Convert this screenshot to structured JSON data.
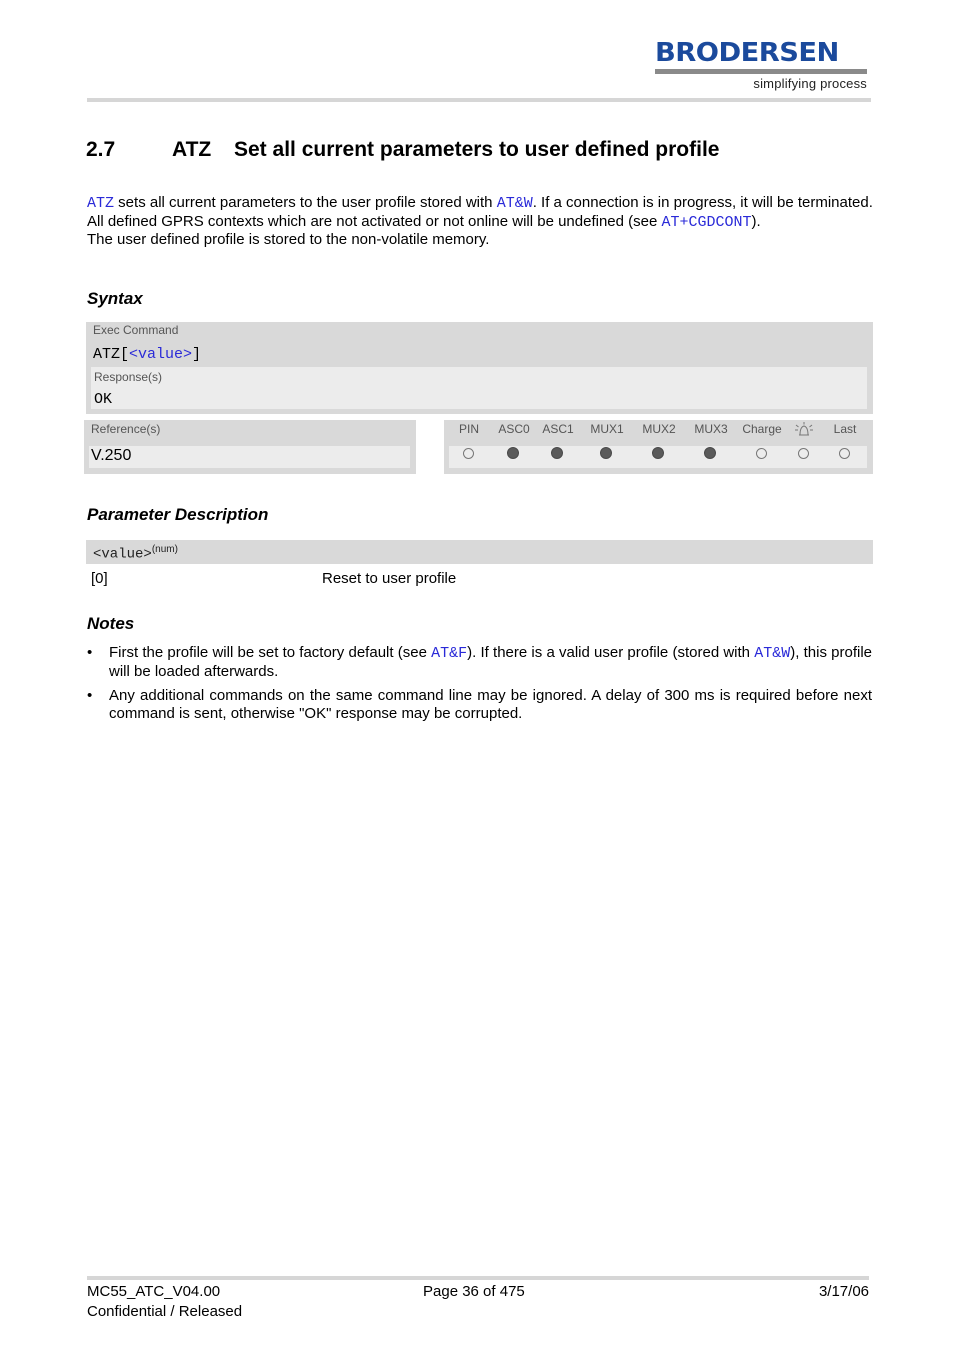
{
  "header": {
    "logo_word": "BRODERSEN",
    "logo_tagline": "simplifying process"
  },
  "title": {
    "number": "2.7",
    "command": "ATZ",
    "text": "Set all current parameters to user defined profile"
  },
  "intro": {
    "line1_link1": "ATZ",
    "line1_text1": " sets all current parameters to the user profile stored with ",
    "line1_link2": "AT&W",
    "line1_text2": ". If a connection is in progress, it will be terminated.",
    "line2_text1": "All defined GPRS contexts which are not activated or not online will be undefined (see ",
    "line2_link": "AT+CGDCONT",
    "line2_text2": ").",
    "line3": "The user defined profile is stored to the non-volatile memory."
  },
  "syntax": {
    "heading": "Syntax",
    "exec_label": "Exec Command",
    "exec_cmd_prefix": "ATZ[",
    "exec_cmd_param": "<value>",
    "exec_cmd_suffix": "]",
    "response_label": "Response(s)",
    "response_value": "OK",
    "reference_label": "Reference(s)",
    "reference_value": "V.250",
    "flags": [
      {
        "label": "PIN",
        "state": "off",
        "icon": null
      },
      {
        "label": "ASC0",
        "state": "on",
        "icon": null
      },
      {
        "label": "ASC1",
        "state": "on",
        "icon": null
      },
      {
        "label": "MUX1",
        "state": "on",
        "icon": null
      },
      {
        "label": "MUX2",
        "state": "on",
        "icon": null
      },
      {
        "label": "MUX3",
        "state": "on",
        "icon": null
      },
      {
        "label": "Charge",
        "state": "off",
        "icon": null
      },
      {
        "label": "",
        "state": "off",
        "icon": "alarm-bell-icon"
      },
      {
        "label": "Last",
        "state": "off",
        "icon": null
      }
    ]
  },
  "parameters": {
    "heading": "Parameter Description",
    "name": "<value>",
    "type": "(num)",
    "rows": [
      {
        "value": "[0]",
        "description": "Reset to user profile"
      }
    ]
  },
  "notes": {
    "heading": "Notes",
    "items": [
      {
        "bullet": "•",
        "t1": "First the profile will be set to factory default (see ",
        "link1": "AT&F",
        "t2": "). If there is a valid user profile (stored with ",
        "link2": "AT&W",
        "t3": "), this profile will be loaded afterwards."
      },
      {
        "bullet": "•",
        "t1": "Any additional commands on the same command line may be ignored. A delay of 300 ms is required before next command is sent, otherwise \"OK\" response may be corrupted."
      }
    ]
  },
  "footer": {
    "doc_id": "MC55_ATC_V04.00",
    "status": "Confidential / Released",
    "page": "Page 36 of 475",
    "date": "3/17/06"
  }
}
